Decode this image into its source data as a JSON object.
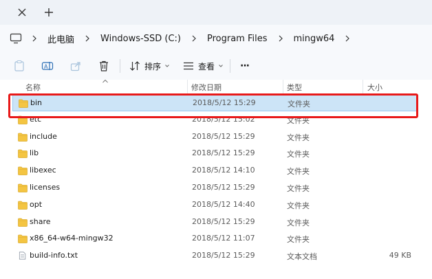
{
  "addressbar": {
    "crumbs": [
      "此电脑",
      "Windows-SSD (C:)",
      "Program Files",
      "mingw64"
    ]
  },
  "toolbar": {
    "sort_label": "排序",
    "view_label": "查看",
    "more_label": "···"
  },
  "columns": {
    "name": "名称",
    "date": "修改日期",
    "type": "类型",
    "size": "大小"
  },
  "files": [
    {
      "name": "bin",
      "date": "2018/5/12 15:29",
      "type": "文件夹",
      "size": "",
      "icon": "folder-icon",
      "selected": true
    },
    {
      "name": "etc",
      "date": "2018/5/12 15:02",
      "type": "文件夹",
      "size": "",
      "icon": "folder-icon"
    },
    {
      "name": "include",
      "date": "2018/5/12 15:29",
      "type": "文件夹",
      "size": "",
      "icon": "folder-icon"
    },
    {
      "name": "lib",
      "date": "2018/5/12 15:29",
      "type": "文件夹",
      "size": "",
      "icon": "folder-icon"
    },
    {
      "name": "libexec",
      "date": "2018/5/12 14:10",
      "type": "文件夹",
      "size": "",
      "icon": "folder-icon"
    },
    {
      "name": "licenses",
      "date": "2018/5/12 15:29",
      "type": "文件夹",
      "size": "",
      "icon": "folder-icon"
    },
    {
      "name": "opt",
      "date": "2018/5/12 14:40",
      "type": "文件夹",
      "size": "",
      "icon": "folder-icon"
    },
    {
      "name": "share",
      "date": "2018/5/12 15:29",
      "type": "文件夹",
      "size": "",
      "icon": "folder-icon"
    },
    {
      "name": "x86_64-w64-mingw32",
      "date": "2018/5/12 11:07",
      "type": "文件夹",
      "size": "",
      "icon": "folder-icon"
    },
    {
      "name": "build-info.txt",
      "date": "2018/5/12 15:29",
      "type": "文本文档",
      "size": "49 KB",
      "icon": "text-file-icon"
    }
  ],
  "colors": {
    "selection_bg": "#cce4f7",
    "selection_border": "#99c9ef",
    "highlight": "#e81919",
    "folder": "#f4c542"
  }
}
